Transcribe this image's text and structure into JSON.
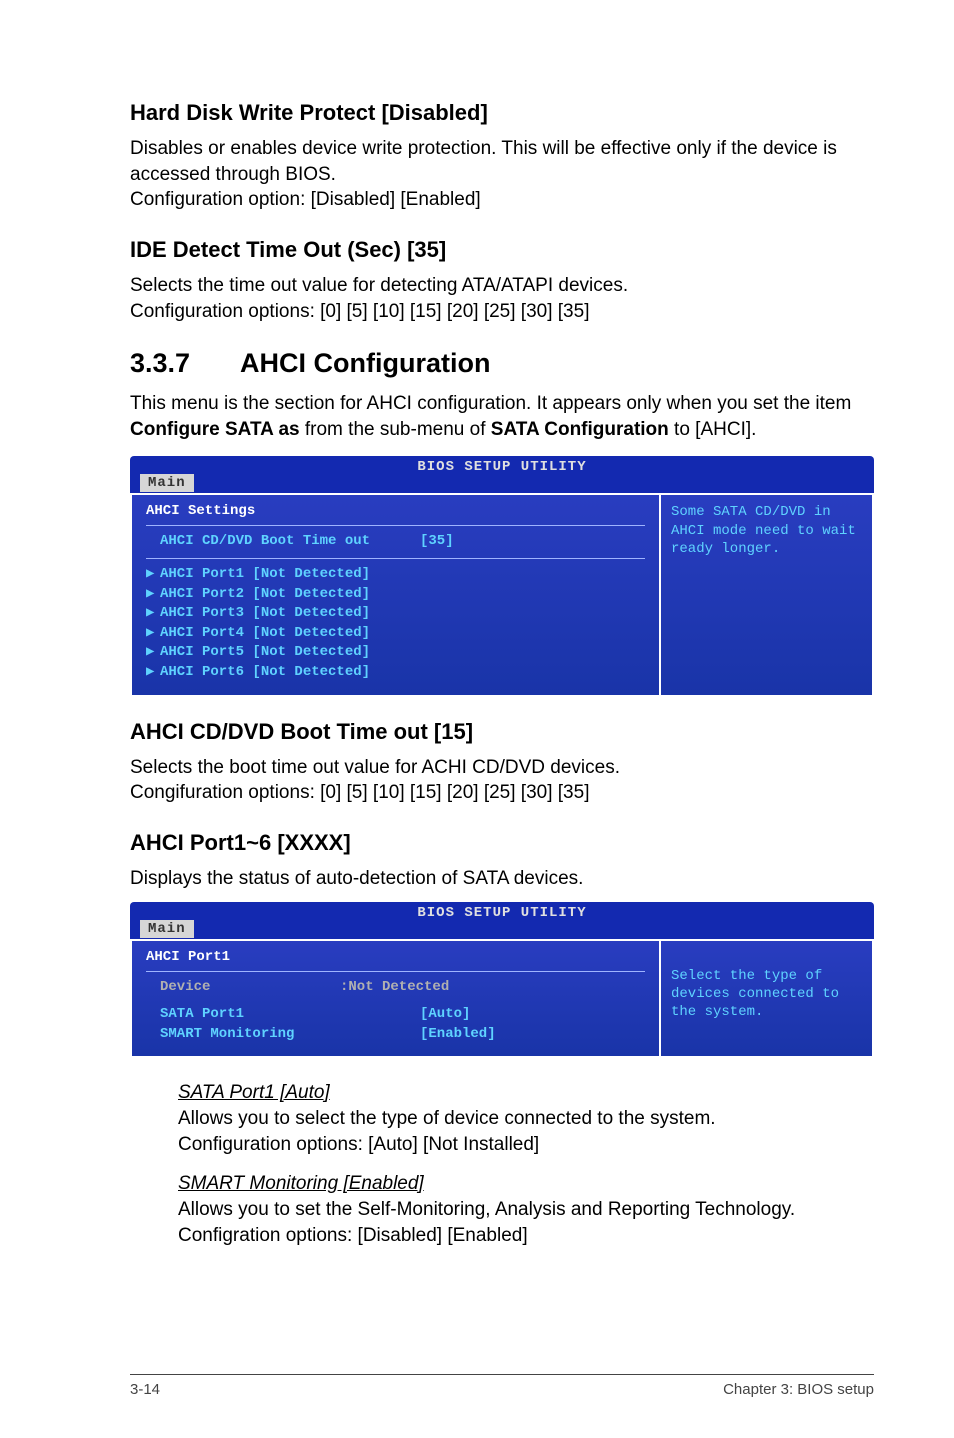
{
  "sec1": {
    "title": "Hard Disk Write Protect [Disabled]",
    "p1": "Disables or enables device write protection. This will be effective only if the device is accessed through BIOS.",
    "p2": "Configuration option: [Disabled] [Enabled]"
  },
  "sec2": {
    "title": "IDE Detect Time Out (Sec) [35]",
    "p1": "Selects the time out value for detecting ATA/ATAPI devices.",
    "p2": "Configuration options: [0] [5] [10] [15] [20] [25] [30] [35]"
  },
  "sec3": {
    "num": "3.3.7",
    "title": "AHCI Configuration",
    "p1a": "This menu is the section for AHCI configuration. It appears only when you set the item ",
    "p1b": "Configure SATA as",
    "p1c": " from the sub-menu of ",
    "p1d": "SATA Configuration",
    "p1e": " to [AHCI]."
  },
  "bios1": {
    "headerTitle": "BIOS SETUP UTILITY",
    "tab": "Main",
    "settingsTitle": "AHCI Settings",
    "bootTimeLabel": "AHCI CD/DVD Boot Time out",
    "bootTimeVal": "[35]",
    "ports": [
      {
        "label": "AHCI Port1 [Not Detected]"
      },
      {
        "label": "AHCI Port2 [Not Detected]"
      },
      {
        "label": "AHCI Port3 [Not Detected]"
      },
      {
        "label": "AHCI Port4 [Not Detected]"
      },
      {
        "label": "AHCI Port5 [Not Detected]"
      },
      {
        "label": "AHCI Port6 [Not Detected]"
      }
    ],
    "help": "Some SATA CD/DVD in AHCI mode need to wait ready longer."
  },
  "sec4": {
    "title": "AHCI CD/DVD Boot Time out [15]",
    "p1": "Selects the boot time out value for ACHI CD/DVD devices.",
    "p2": "Congifuration options: [0] [5] [10] [15] [20] [25] [30] [35]"
  },
  "sec5": {
    "title": "AHCI Port1~6 [XXXX]",
    "p1": "Displays the status of auto-detection of SATA devices."
  },
  "bios2": {
    "headerTitle": "BIOS SETUP UTILITY",
    "tab": "Main",
    "settingsTitle": "AHCI Port1",
    "deviceLabel": "Device",
    "deviceVal": ":Not Detected",
    "sataPortLabel": "SATA Port1",
    "sataPortVal": "[Auto]",
    "smartLabel": "SMART Monitoring",
    "smartVal": "[Enabled]",
    "help": "Select the type of devices connected to the system."
  },
  "sub1": {
    "title": "SATA Port1 [Auto]",
    "p1": "Allows you to select the type of device connected to the system.",
    "p2": "Configuration options: [Auto] [Not Installed]"
  },
  "sub2": {
    "title": "SMART Monitoring [Enabled]",
    "p1": "Allows you to set the Self-Monitoring, Analysis and Reporting Technology.",
    "p2": "Configration options: [Disabled] [Enabled]"
  },
  "footer": {
    "left": "3-14",
    "right": "Chapter 3: BIOS setup"
  }
}
